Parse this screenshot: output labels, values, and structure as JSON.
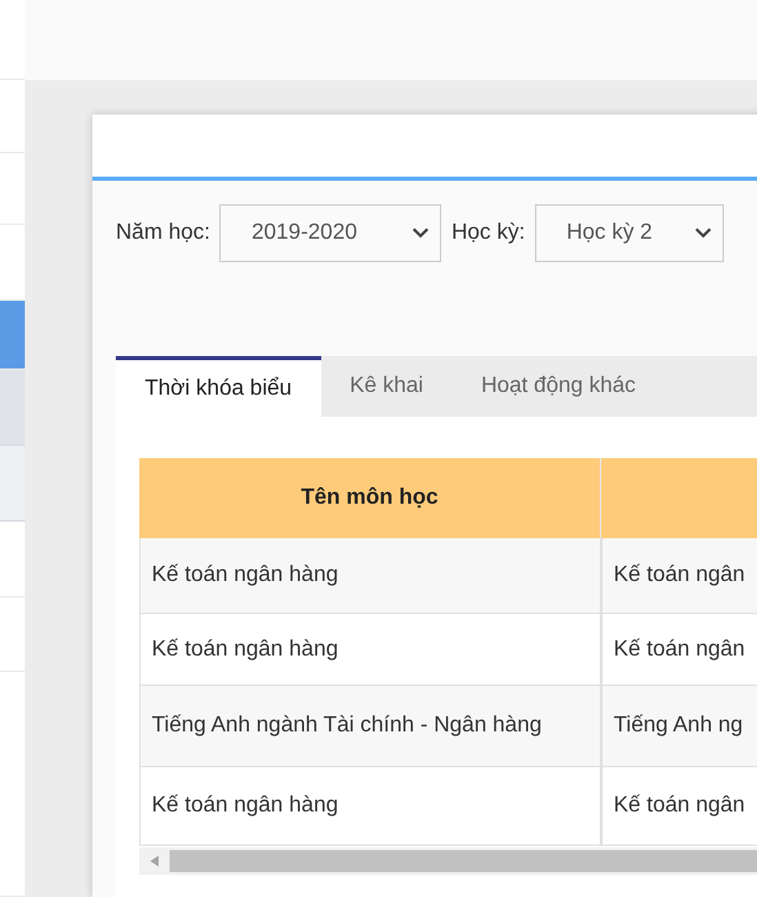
{
  "sidebar": {
    "items": [
      {
        "kind": "plain",
        "selected": false
      },
      {
        "kind": "plain",
        "selected": false
      },
      {
        "kind": "plain",
        "selected": false
      },
      {
        "kind": "plain",
        "selected": false
      },
      {
        "kind": "plain",
        "selected": true
      },
      {
        "kind": "sub-hover",
        "selected": false
      },
      {
        "kind": "sub",
        "selected": false
      },
      {
        "kind": "plain",
        "selected": false
      },
      {
        "kind": "plain",
        "selected": false
      },
      {
        "kind": "plain",
        "selected": false
      }
    ]
  },
  "filters": [
    {
      "label": "Năm học:",
      "value": "2019-2020"
    },
    {
      "label": "Học kỳ:",
      "value": "Học kỳ 2"
    }
  ],
  "tabs": [
    {
      "label": "Thời khóa biểu",
      "selected": true
    },
    {
      "label": "Kê khai",
      "selected": false
    },
    {
      "label": "Hoạt động khác",
      "selected": false
    }
  ],
  "table": {
    "columns": [
      "Tên môn học"
    ],
    "rows": [
      [
        "Kế toán ngân hàng",
        "Kế toán ngân"
      ],
      [
        "Kế toán ngân hàng",
        "Kế toán ngân"
      ],
      [
        "Tiếng Anh ngành Tài chính - Ngân hàng",
        "Tiếng Anh ng"
      ],
      [
        "Kế toán ngân hàng",
        "Kế toán ngân"
      ]
    ]
  }
}
